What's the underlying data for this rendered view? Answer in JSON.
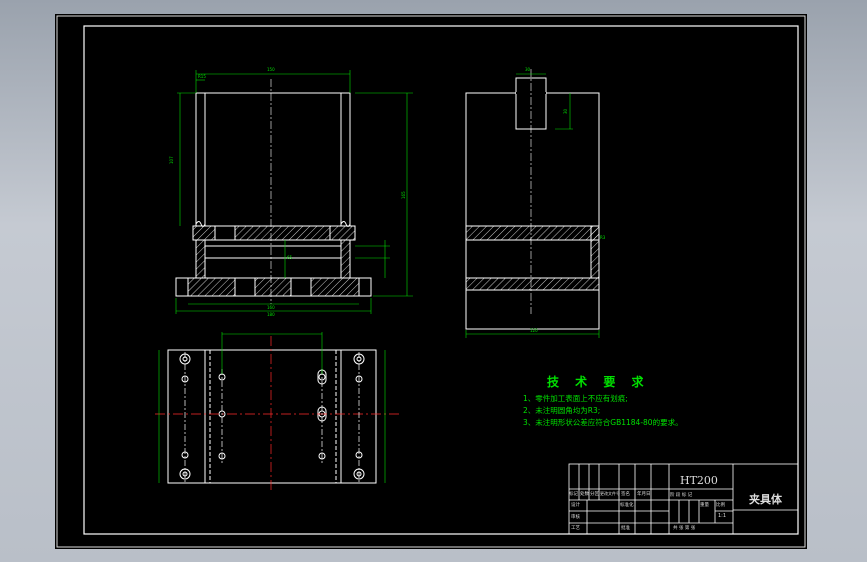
{
  "technical_requirements": {
    "title": "技 术 要 求",
    "items": [
      "1、零件加工表面上不应有划痕;",
      "2、未注明圆角均为R3;",
      "3、未注明形状公差应符合GB1184-80的要求。"
    ]
  },
  "title_block": {
    "material": "HT200",
    "part_name": "夹具体",
    "scale": "1:1",
    "row_labels": {
      "revision": "标记",
      "count": "处数",
      "zone": "分区",
      "change_doc": "更改文件号",
      "signature": "签名",
      "date": "年月日",
      "design": "设计",
      "standardize": "标准化",
      "check": "审核",
      "process": "工艺",
      "approve": "批准"
    },
    "col_labels": {
      "stage_mark": "阶 段 标 记",
      "weight": "重量",
      "ratio": "比例",
      "sheets": "共  张  第  张"
    }
  },
  "colors": {
    "background": "#000000",
    "outline": "#ffffff",
    "dimension": "#00e000",
    "centerline": "#ff2a2a",
    "text": "#00e000"
  }
}
